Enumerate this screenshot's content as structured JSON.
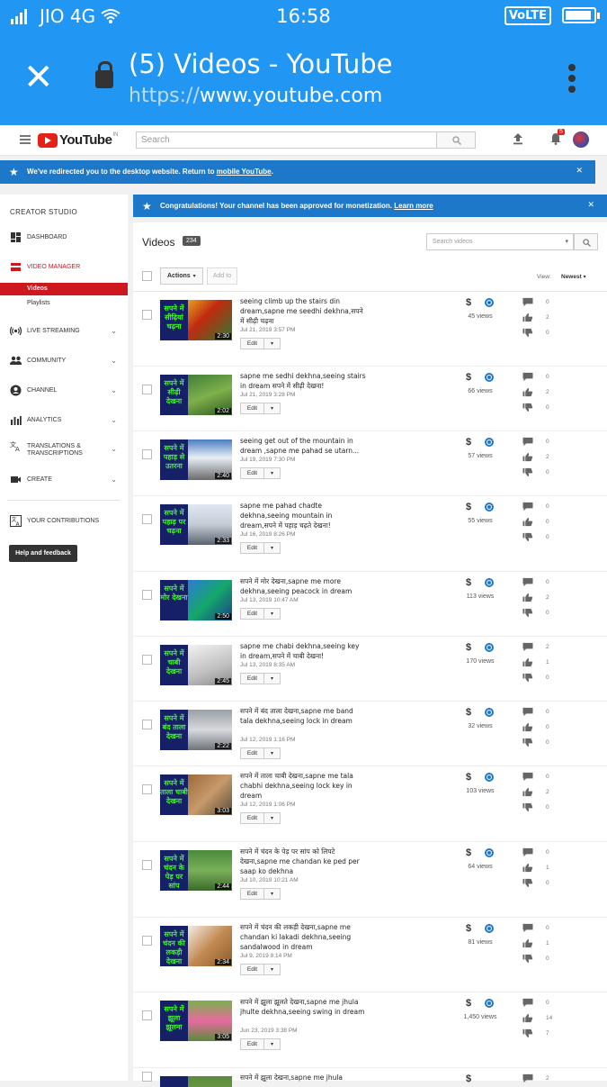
{
  "status_bar": {
    "carrier": "JIO 4G",
    "time": "16:58",
    "volte": "VoLTE"
  },
  "browser": {
    "page_title": "(5) Videos - YouTube",
    "url_protocol": "https://",
    "url_host": "www.youtube.com"
  },
  "yt_header": {
    "logo_text": "YouTube",
    "logo_region": "IN",
    "search_placeholder": "Search",
    "notification_count": "5"
  },
  "redirect_banner": {
    "message": "We've redirected you to the desktop website. Return to ",
    "link": "mobile YouTube",
    "suffix": "."
  },
  "monetization_banner": {
    "message": "Congratulations! Your channel has been approved for monetization. ",
    "link": "Learn more"
  },
  "sidebar": {
    "heading": "CREATOR STUDIO",
    "items": [
      {
        "label": "DASHBOARD"
      },
      {
        "label": "VIDEO MANAGER",
        "sub": [
          "Videos",
          "Playlists"
        ]
      },
      {
        "label": "LIVE STREAMING"
      },
      {
        "label": "COMMUNITY"
      },
      {
        "label": "CHANNEL"
      },
      {
        "label": "ANALYTICS"
      },
      {
        "label": "TRANSLATIONS & TRANSCRIPTIONS"
      },
      {
        "label": "CREATE"
      },
      {
        "label": "YOUR CONTRIBUTIONS"
      }
    ],
    "help_button": "Help and feedback"
  },
  "videos": {
    "heading": "Videos",
    "count": "234",
    "search_placeholder": "Search videos",
    "actions_label": "Actions",
    "add_to_label": "Add to",
    "view_label": "View:",
    "sort_label": "Newest",
    "edit_label": "Edit",
    "list": [
      {
        "thumb_text": "सपने में सीढ़ियां चढ़ना",
        "duration": "2:30",
        "title": "seeing climb up the stairs din dream,sapne me seedhi dekhna,सपने में सीढ़ी चढ़ना",
        "date": "Jul 21, 2019 3:57 PM",
        "views": "45 views",
        "comments": "0",
        "likes": "2",
        "dislikes": "0"
      },
      {
        "thumb_text": "सपने में सीढ़ी देखना",
        "duration": "2:02",
        "title": "sapne me sedhi dekhna,seeing stairs in dream सपने में सीढ़ी देखना!",
        "date": "Jul 21, 2019 3:28 PM",
        "views": "66 views",
        "comments": "0",
        "likes": "2",
        "dislikes": "0"
      },
      {
        "thumb_text": "सपने में पहाड़ से उतरना",
        "duration": "2:40",
        "title": "seeing get out of the mountain in dream ,sapne me pahad se utarn...",
        "date": "Jul 19, 2019 7:30 PM",
        "views": "57 views",
        "comments": "0",
        "likes": "2",
        "dislikes": "0"
      },
      {
        "thumb_text": "सपने में पहाड़ पर चढ़ना",
        "duration": "2:33",
        "title": "sapne me pahad chadte dekhna,seeing mountain in dream,सपने में पहाड़ चढ़ते देखना!",
        "date": "Jul 16, 2019 8:26 PM",
        "views": "55 views",
        "comments": "0",
        "likes": "0",
        "dislikes": "0"
      },
      {
        "thumb_text": "सपने में मोर देखना",
        "duration": "2:50",
        "title": "सपने में मोर देखना,sapne me more dekhna,seeing peacock in dream",
        "date": "Jul 13, 2019 10:47 AM",
        "views": "113 views",
        "comments": "0",
        "likes": "2",
        "dislikes": "0"
      },
      {
        "thumb_text": "सपने में चाबी देखना",
        "duration": "2:45",
        "title": "sapne me chabi dekhna,seeing key in dream,सपने में चाबी देखना!",
        "date": "Jul 13, 2019 8:35 AM",
        "views": "170 views",
        "comments": "2",
        "likes": "1",
        "dislikes": "0"
      },
      {
        "thumb_text": "सपने में बंद ताला देखना",
        "duration": "2:22",
        "title": "सपने में बंद ताला देखना,sapne me band tala dekhna,seeing lock in dream",
        "date": "Jul 12, 2019 1:16 PM",
        "views": "32 views",
        "comments": "0",
        "likes": "0",
        "dislikes": "0"
      },
      {
        "thumb_text": "सपने में ताला चाबी देखना",
        "duration": "3:03",
        "title": "सपने में ताला चाबी देखना,sapne me tala chabhi dekhna,seeing lock key in dream",
        "date": "Jul 12, 2019 1:06 PM",
        "views": "103 views",
        "comments": "0",
        "likes": "2",
        "dislikes": "0"
      },
      {
        "thumb_text": "सपने में चंदन के पेड़ पर सांप देखना",
        "duration": "2:44",
        "title": "सपने में चंदन के पेड़ पर सांप को लिपटे देखना,sapne me chandan ke ped per saap ko dekhna",
        "date": "Jul 10, 2019 10:21 AM",
        "views": "64 views",
        "comments": "0",
        "likes": "1",
        "dislikes": "0"
      },
      {
        "thumb_text": "सपने में चंदन की लकड़ी देखना",
        "duration": "2:34",
        "title": "सपने में चंदन की लकड़ी देखना,sapne me chandan ki lakadi dekhna,seeing sandalwood in dream",
        "date": "Jul 9, 2019 8:14 PM",
        "views": "81 views",
        "comments": "0",
        "likes": "1",
        "dislikes": "0"
      },
      {
        "thumb_text": "सपने में झूला झूलना",
        "duration": "3:05",
        "title": "सपने में झूला झूलते देखना,sapne me jhula jhulte dekhna,seeing swing in dream",
        "date": "Jun 23, 2019 3:38 PM",
        "views": "1,450 views",
        "comments": "0",
        "likes": "14",
        "dislikes": "7"
      },
      {
        "thumb_text": "",
        "duration": "",
        "title": "सपने में झूला देखना,sapne me jhula",
        "date": "",
        "views": "",
        "comments": "2",
        "likes": "",
        "dislikes": ""
      }
    ]
  },
  "colors": {
    "chrome_blue": "#2196f3",
    "banner_blue": "#1e78c9",
    "yt_red": "#cc181e"
  }
}
